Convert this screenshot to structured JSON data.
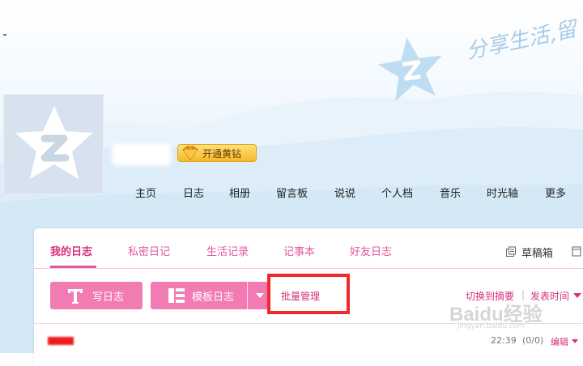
{
  "banner": {
    "slogan": "分享生活,留"
  },
  "profile": {
    "vip_button_label": "开通黄钻"
  },
  "nav": {
    "items": [
      "主页",
      "日志",
      "相册",
      "留言板",
      "说说",
      "个人档",
      "音乐",
      "时光轴",
      "更多"
    ]
  },
  "tabs": {
    "items": [
      "我的日志",
      "私密日记",
      "生活记录",
      "记事本",
      "好友日志"
    ],
    "active": "我的日志"
  },
  "draft_box": {
    "label": "草稿箱"
  },
  "toolbar": {
    "write_label": "写日志",
    "template_label": "模板日志",
    "batch_label": "批量管理",
    "toggle_summary_label": "切换到摘要",
    "sort_label": "发表时间",
    "separator": "|"
  },
  "entries": [
    {
      "time": "22:39",
      "counts": "(0/0)",
      "edit_label": "编辑"
    }
  ],
  "watermark": {
    "brand": "Baidu经验",
    "url": "jingyan.baidu.com"
  },
  "colors": {
    "accent": "#e0589c",
    "button": "#f27bb4",
    "highlight": "#ee2a2a",
    "vip": "#f4b82c"
  }
}
